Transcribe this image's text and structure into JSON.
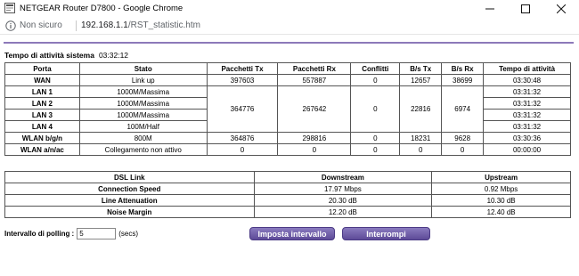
{
  "window": {
    "title": "NETGEAR Router D7800 - Google Chrome",
    "controls": [
      "minimize",
      "maximize",
      "close"
    ]
  },
  "address": {
    "security_text": "Non sicuro",
    "url_host": "192.168.1.1",
    "url_path": "/RST_statistic.htm"
  },
  "uptime": {
    "label": "Tempo di attività sistema",
    "value": "03:32:12"
  },
  "stats": {
    "headers": [
      "Porta",
      "Stato",
      "Pacchetti Tx",
      "Pacchetti Rx",
      "Conflitti",
      "B/s Tx",
      "B/s Rx",
      "Tempo di attività"
    ],
    "wan": {
      "port": "WAN",
      "status": "Link up",
      "tx": "397603",
      "rx": "557887",
      "coll": "0",
      "bstx": "12657",
      "bsrx": "38699",
      "uptime": "03:30:48"
    },
    "lan": [
      {
        "port": "LAN 1",
        "status": "1000M/Massima",
        "uptime": "03:31:32"
      },
      {
        "port": "LAN 2",
        "status": "1000M/Massima",
        "uptime": "03:31:32"
      },
      {
        "port": "LAN 3",
        "status": "1000M/Massima",
        "uptime": "03:31:32"
      },
      {
        "port": "LAN 4",
        "status": "100M/Half",
        "uptime": "03:31:32"
      }
    ],
    "lan_shared": {
      "tx": "364776",
      "rx": "267642",
      "coll": "0",
      "bstx": "22816",
      "bsrx": "6974"
    },
    "wlan_bgn": {
      "port": "WLAN b/g/n",
      "status": "800M",
      "tx": "364876",
      "rx": "298816",
      "coll": "0",
      "bstx": "18231",
      "bsrx": "9628",
      "uptime": "03:30:36"
    },
    "wlan_anac": {
      "port": "WLAN a/n/ac",
      "status": "Collegamento non attivo",
      "tx": "0",
      "rx": "0",
      "coll": "0",
      "bstx": "0",
      "bsrx": "0",
      "uptime": "00:00:00"
    }
  },
  "dsl": {
    "headers": [
      "DSL Link",
      "Downstream",
      "Upstream"
    ],
    "rows": [
      {
        "label": "Connection Speed",
        "down": "17.97 Mbps",
        "up": "0.92 Mbps"
      },
      {
        "label": "Line Attenuation",
        "down": "20.30 dB",
        "up": "10.30 dB"
      },
      {
        "label": "Noise Margin",
        "down": "12.20 dB",
        "up": "12.40 dB"
      }
    ]
  },
  "polling": {
    "label": "Intervallo di polling :",
    "value": "5",
    "unit": "(secs)",
    "set_button": "Imposta intervallo",
    "stop_button": "Interrompi"
  },
  "colors": {
    "accent": "#8c79b9",
    "button": "#6a58a6"
  }
}
